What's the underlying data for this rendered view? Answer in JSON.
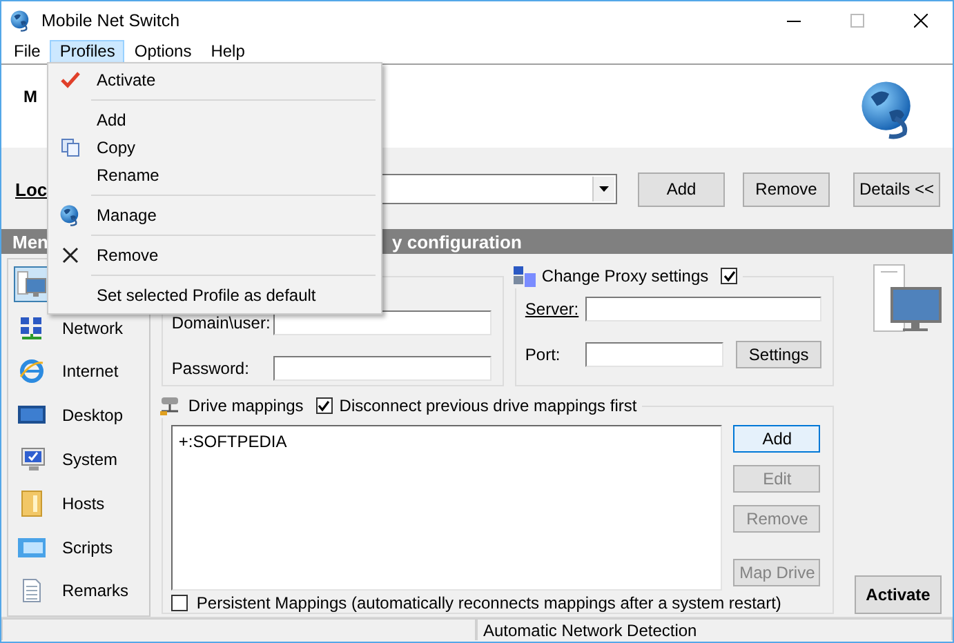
{
  "window": {
    "title": "Mobile Net Switch"
  },
  "menu_bar": [
    {
      "label": "File",
      "selected": false
    },
    {
      "label": "Profiles",
      "selected": true
    },
    {
      "label": "Options",
      "selected": false
    },
    {
      "label": "Help",
      "selected": false
    }
  ],
  "profiles_menu": {
    "groups": [
      [
        {
          "kind": "check",
          "label": "Activate"
        }
      ],
      [
        {
          "kind": "plain",
          "label": "Add"
        },
        {
          "kind": "copy",
          "label": "Copy"
        },
        {
          "kind": "plain",
          "label": "Rename"
        }
      ],
      [
        {
          "kind": "globe",
          "label": "Manage"
        }
      ],
      [
        {
          "kind": "cross",
          "label": "Remove"
        }
      ],
      [
        {
          "kind": "plain",
          "label": "Set selected Profile as default"
        }
      ]
    ]
  },
  "header": {
    "title": "M"
  },
  "location": {
    "label": "Loc",
    "buttons": [
      "Add",
      "Remove"
    ],
    "details_button": "Details <<"
  },
  "section_bar": {
    "left": "Men",
    "right": "y configuration"
  },
  "sidebar": {
    "items": [
      {
        "selected": true
      },
      {
        "label": "Network",
        "selected": false
      },
      {
        "label": "Internet",
        "selected": false
      },
      {
        "label": "Desktop",
        "selected": false
      },
      {
        "label": "System",
        "selected": false
      },
      {
        "label": "Hosts",
        "selected": false
      },
      {
        "label": "Scripts",
        "selected": false
      },
      {
        "label": "Remarks",
        "selected": false
      }
    ]
  },
  "credentials": {
    "fields": [
      {
        "label": "Domain\\user:"
      },
      {
        "label": "Password:"
      }
    ]
  },
  "proxy": {
    "title": "Change Proxy settings",
    "checked": true,
    "server_label": "Server:",
    "port_label": "Port:",
    "settings_button": "Settings"
  },
  "drive_mappings": {
    "title": "Drive mappings",
    "disconnect": {
      "label": "Disconnect previous drive mappings first",
      "checked": true
    },
    "items": [
      "+:SOFTPEDIA"
    ],
    "buttons": [
      {
        "label": "Add",
        "disabled": false,
        "focused": true
      },
      {
        "label": "Edit",
        "disabled": true,
        "focused": false
      },
      {
        "label": "Remove",
        "disabled": true,
        "focused": false
      },
      {
        "label": "Map Drive",
        "disabled": true,
        "focused": false
      }
    ],
    "persistent": {
      "label": "Persistent Mappings (automatically reconnects mappings after a system restart)",
      "checked": false
    }
  },
  "activate_button": "Activate",
  "status_bar": {
    "text": "Automatic Network Detection"
  }
}
